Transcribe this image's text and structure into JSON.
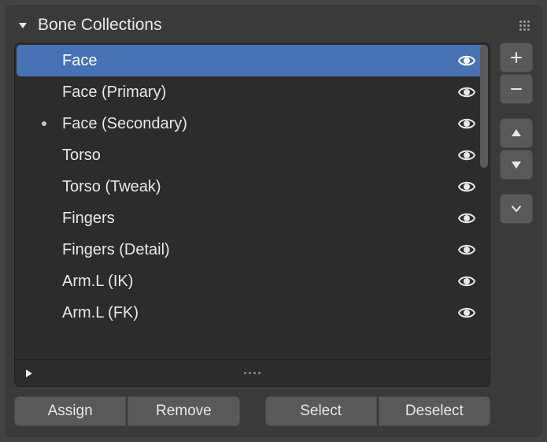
{
  "panel": {
    "title": "Bone Collections"
  },
  "list": {
    "items": [
      {
        "label": "Face",
        "visible": true,
        "selected": true,
        "has_bullet": false
      },
      {
        "label": "Face (Primary)",
        "visible": true,
        "selected": false,
        "has_bullet": false
      },
      {
        "label": "Face (Secondary)",
        "visible": true,
        "selected": false,
        "has_bullet": true
      },
      {
        "label": "Torso",
        "visible": true,
        "selected": false,
        "has_bullet": false
      },
      {
        "label": "Torso (Tweak)",
        "visible": true,
        "selected": false,
        "has_bullet": false
      },
      {
        "label": "Fingers",
        "visible": true,
        "selected": false,
        "has_bullet": false
      },
      {
        "label": "Fingers (Detail)",
        "visible": true,
        "selected": false,
        "has_bullet": false
      },
      {
        "label": "Arm.L (IK)",
        "visible": true,
        "selected": false,
        "has_bullet": false
      },
      {
        "label": "Arm.L (FK)",
        "visible": true,
        "selected": false,
        "has_bullet": false
      }
    ]
  },
  "buttons": {
    "assign": "Assign",
    "remove": "Remove",
    "select": "Select",
    "deselect": "Deselect"
  }
}
